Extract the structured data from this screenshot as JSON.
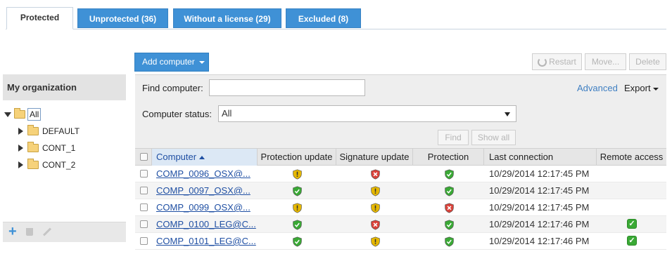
{
  "tabs": [
    {
      "label": "Protected",
      "active": true
    },
    {
      "label": "Unprotected (36)",
      "active": false
    },
    {
      "label": "Without a license (29)",
      "active": false
    },
    {
      "label": "Excluded (8)",
      "active": false
    }
  ],
  "toolbar": {
    "add_computer": "Add computer",
    "restart": "Restart",
    "move": "Move...",
    "delete": "Delete"
  },
  "left_panel": {
    "title": "My organization",
    "tree": [
      {
        "label": "All",
        "level": 0,
        "expanded": true,
        "selected": true
      },
      {
        "label": "DEFAULT",
        "level": 1
      },
      {
        "label": "CONT_1",
        "level": 1
      },
      {
        "label": "CONT_2",
        "level": 1
      }
    ]
  },
  "filter": {
    "find_label": "Find computer:",
    "find_value": "",
    "advanced": "Advanced",
    "export": "Export",
    "status_label": "Computer status:",
    "status_value": "All",
    "find_button": "Find",
    "show_all_button": "Show all"
  },
  "table": {
    "columns": [
      "Computer",
      "Protection update",
      "Signature update",
      "Protection",
      "Last connection",
      "Remote access"
    ],
    "rows": [
      {
        "computer": "COMP_0096_OSX@...",
        "protection_update": "warning",
        "signature_update": "error",
        "protection": "ok",
        "last_connection": "10/29/2014 12:17:45 PM",
        "remote_access": false
      },
      {
        "computer": "COMP_0097_OSX@...",
        "protection_update": "ok",
        "signature_update": "warning",
        "protection": "ok",
        "last_connection": "10/29/2014 12:17:45 PM",
        "remote_access": false
      },
      {
        "computer": "COMP_0099_OSX@...",
        "protection_update": "warning",
        "signature_update": "warning",
        "protection": "error",
        "last_connection": "10/29/2014 12:17:45 PM",
        "remote_access": false
      },
      {
        "computer": "COMP_0100_LEG@C...",
        "protection_update": "ok",
        "signature_update": "error",
        "protection": "ok",
        "last_connection": "10/29/2014 12:17:46 PM",
        "remote_access": true
      },
      {
        "computer": "COMP_0101_LEG@C...",
        "protection_update": "ok",
        "signature_update": "warning",
        "protection": "ok",
        "last_connection": "10/29/2014 12:17:46 PM",
        "remote_access": true
      }
    ]
  },
  "colors": {
    "accent": "#3f91d6",
    "ok": "#3aa935",
    "warning": "#e6b800",
    "error": "#d9423a",
    "link": "#1f4fa3"
  }
}
